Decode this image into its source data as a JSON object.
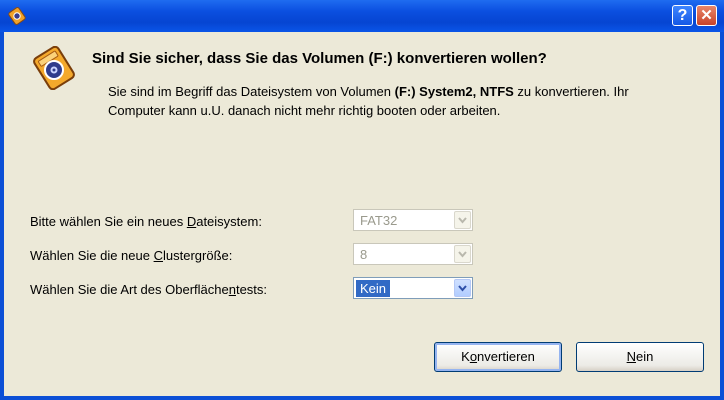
{
  "titlebar": {
    "help_label": "?",
    "close_label": "✕",
    "icon": "disk-convert-icon"
  },
  "dialog": {
    "icon": "disk-convert-icon",
    "headline": "Sind Sie sicher, dass Sie das Volumen (F:) konvertieren wollen?",
    "description_part1": "Sie sind im Begriff das Dateisystem von Volumen ",
    "volume": "(F:) System2, NTFS",
    "description_part2": " zu konvertieren. Ihr Computer kann u.U. danach nicht mehr richtig booten oder arbeiten."
  },
  "form": {
    "filesystem": {
      "label_pre": "Bitte wählen Sie ein neues ",
      "label_key": "D",
      "label_post": "ateisystem:",
      "value": "FAT32"
    },
    "cluster": {
      "label_pre": "Wählen Sie die neue ",
      "label_key": "C",
      "label_post": "lustergröße:",
      "value": "8"
    },
    "surface": {
      "label_pre": "Wählen Sie die Art des Oberfläche",
      "label_key": "n",
      "label_post": "tests:",
      "value": "Kein"
    }
  },
  "buttons": {
    "convert_pre": "K",
    "convert_key": "o",
    "convert_post": "nvertieren",
    "no_key": "N",
    "no_post": "ein"
  }
}
